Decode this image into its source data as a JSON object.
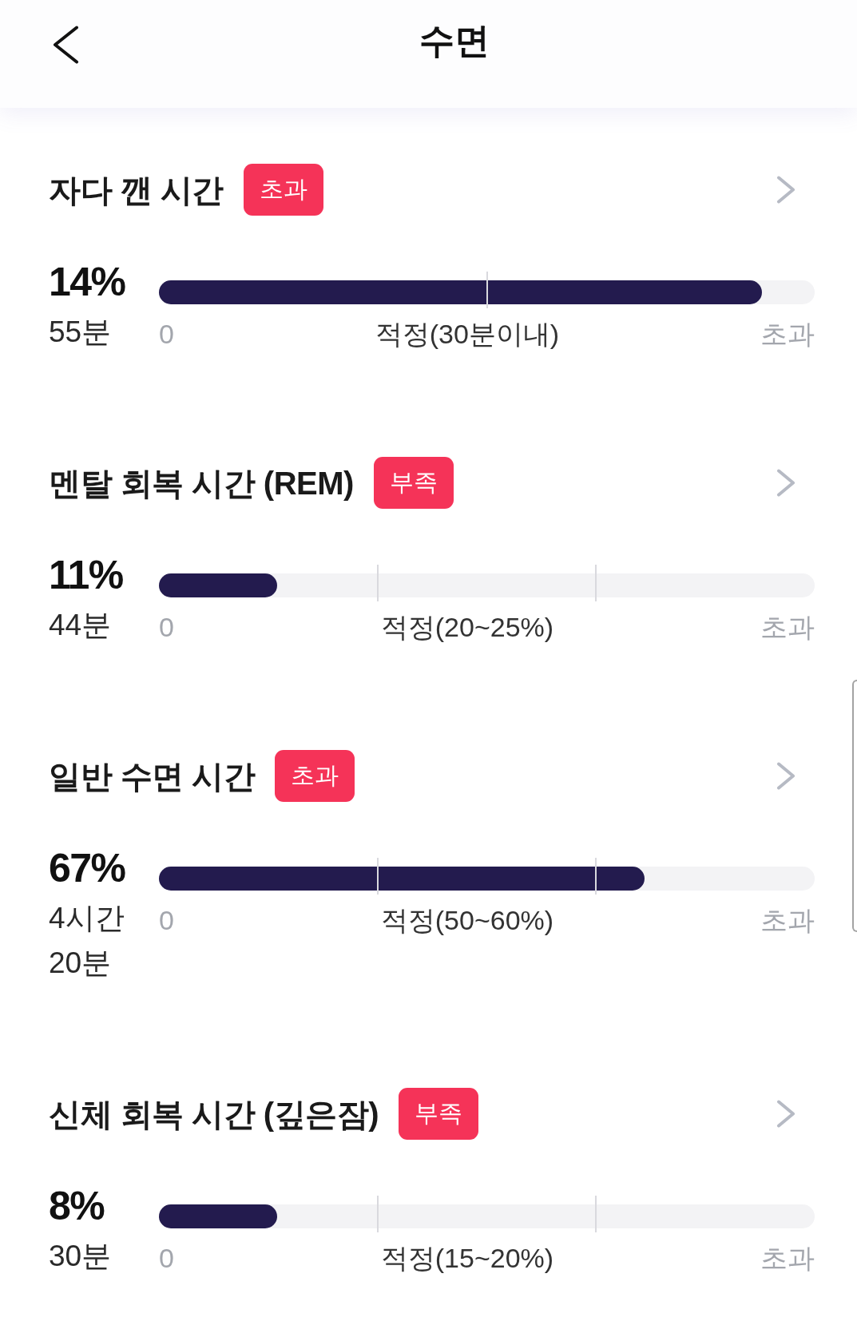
{
  "header": {
    "title": "수면"
  },
  "sections": [
    {
      "title": "자다 깬 시간",
      "status": "초과",
      "percent": "14%",
      "duration": "55분",
      "level": 0.92,
      "kind": "limit",
      "scale_start": "0",
      "target_range": "적정(30분이내)",
      "scale_end": "초과"
    },
    {
      "title": "멘탈 회복 시간 (REM)",
      "status": "부족",
      "percent": "11%",
      "duration": "44분",
      "level": 0.18,
      "kind": "range",
      "scale_start": "0",
      "target_range": "적정(20~25%)",
      "scale_end": "초과"
    },
    {
      "title": "일반 수면 시간",
      "status": "초과",
      "percent": "67%",
      "duration": "4시간 20분",
      "level": 0.74,
      "kind": "range",
      "scale_start": "0",
      "target_range": "적정(50~60%)",
      "scale_end": "초과"
    },
    {
      "title": "신체 회복 시간 (깊은잠)",
      "status": "부족",
      "percent": "8%",
      "duration": "30분",
      "level": 0.18,
      "kind": "range",
      "scale_start": "0",
      "target_range": "적정(15~20%)",
      "scale_end": "초과"
    }
  ]
}
